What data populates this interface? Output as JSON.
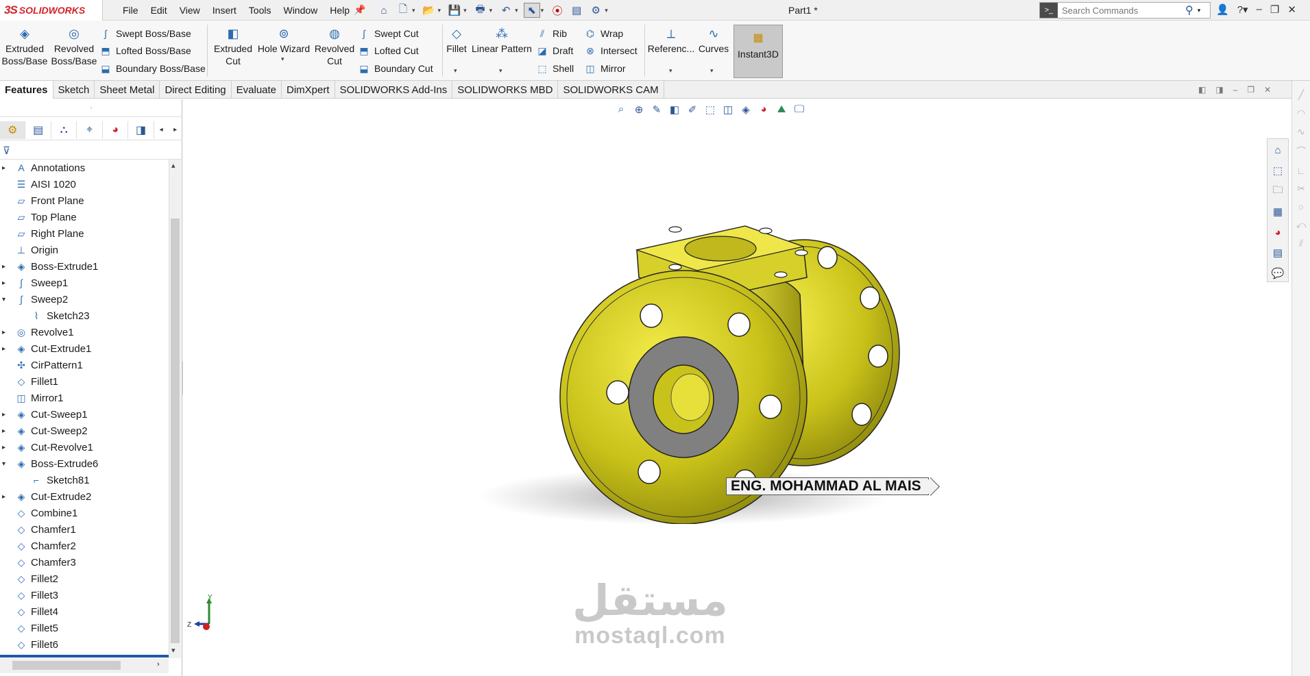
{
  "app": {
    "logo_ds": "3S",
    "logo_text": "SOLIDWORKS",
    "document_title": "Part1 *"
  },
  "menu": [
    "File",
    "Edit",
    "View",
    "Insert",
    "Tools",
    "Window",
    "Help"
  ],
  "search": {
    "placeholder": "Search Commands"
  },
  "commands": {
    "extruded_boss": "Extruded\nBoss/Base",
    "revolved_boss": "Revolved\nBoss/Base",
    "swept_boss": "Swept Boss/Base",
    "lofted_boss": "Lofted Boss/Base",
    "boundary_boss": "Boundary Boss/Base",
    "extruded_cut": "Extruded\nCut",
    "hole_wizard": "Hole Wizard",
    "revolved_cut": "Revolved\nCut",
    "swept_cut": "Swept Cut",
    "lofted_cut": "Lofted Cut",
    "boundary_cut": "Boundary Cut",
    "fillet": "Fillet",
    "linear_pattern": "Linear Pattern",
    "rib": "Rib",
    "draft": "Draft",
    "shell": "Shell",
    "wrap": "Wrap",
    "intersect": "Intersect",
    "mirror": "Mirror",
    "reference": "Referenc...",
    "curves": "Curves",
    "instant3d": "Instant3D"
  },
  "tabs": [
    "Features",
    "Sketch",
    "Sheet Metal",
    "Direct Editing",
    "Evaluate",
    "DimXpert",
    "SOLIDWORKS Add-Ins",
    "SOLIDWORKS MBD",
    "SOLIDWORKS CAM"
  ],
  "active_tab": "Features",
  "tree": [
    {
      "label": "Annotations",
      "icon": "annotations-icon",
      "glyph": "A",
      "expand": "▸"
    },
    {
      "label": "AISI 1020",
      "icon": "material-icon",
      "glyph": "☰",
      "expand": ""
    },
    {
      "label": "Front Plane",
      "icon": "plane-icon",
      "glyph": "▱",
      "expand": ""
    },
    {
      "label": "Top Plane",
      "icon": "plane-icon",
      "glyph": "▱",
      "expand": ""
    },
    {
      "label": "Right Plane",
      "icon": "plane-icon",
      "glyph": "▱",
      "expand": ""
    },
    {
      "label": "Origin",
      "icon": "origin-icon",
      "glyph": "⊥",
      "expand": ""
    },
    {
      "label": "Boss-Extrude1",
      "icon": "boss-extrude-icon",
      "glyph": "◈",
      "expand": "▸"
    },
    {
      "label": "Sweep1",
      "icon": "sweep-icon",
      "glyph": "∫",
      "expand": "▸"
    },
    {
      "label": "Sweep2",
      "icon": "sweep-icon",
      "glyph": "∫",
      "expand": "▾"
    },
    {
      "label": "Sketch23",
      "icon": "sketch-icon",
      "glyph": "⌇",
      "expand": "",
      "child": true
    },
    {
      "label": "Revolve1",
      "icon": "revolve-icon",
      "glyph": "◎",
      "expand": "▸"
    },
    {
      "label": "Cut-Extrude1",
      "icon": "cut-extrude-icon",
      "glyph": "◈",
      "expand": "▸"
    },
    {
      "label": "CirPattern1",
      "icon": "circular-pattern-icon",
      "glyph": "✣",
      "expand": ""
    },
    {
      "label": "Fillet1",
      "icon": "fillet-icon",
      "glyph": "◇",
      "expand": ""
    },
    {
      "label": "Mirror1",
      "icon": "mirror-icon",
      "glyph": "◫",
      "expand": ""
    },
    {
      "label": "Cut-Sweep1",
      "icon": "cut-sweep-icon",
      "glyph": "◈",
      "expand": "▸"
    },
    {
      "label": "Cut-Sweep2",
      "icon": "cut-sweep-icon",
      "glyph": "◈",
      "expand": "▸"
    },
    {
      "label": "Cut-Revolve1",
      "icon": "cut-revolve-icon",
      "glyph": "◈",
      "expand": "▸"
    },
    {
      "label": "Boss-Extrude6",
      "icon": "boss-extrude-icon",
      "glyph": "◈",
      "expand": "▾"
    },
    {
      "label": "Sketch81",
      "icon": "sketch-icon",
      "glyph": "⌐",
      "expand": "",
      "child": true
    },
    {
      "label": "Cut-Extrude2",
      "icon": "cut-extrude-icon",
      "glyph": "◈",
      "expand": "▸"
    },
    {
      "label": "Combine1",
      "icon": "combine-icon",
      "glyph": "◇",
      "expand": ""
    },
    {
      "label": "Chamfer1",
      "icon": "chamfer-icon",
      "glyph": "◇",
      "expand": ""
    },
    {
      "label": "Chamfer2",
      "icon": "chamfer-icon",
      "glyph": "◇",
      "expand": ""
    },
    {
      "label": "Chamfer3",
      "icon": "chamfer-icon",
      "glyph": "◇",
      "expand": ""
    },
    {
      "label": "Fillet2",
      "icon": "fillet-icon",
      "glyph": "◇",
      "expand": ""
    },
    {
      "label": "Fillet3",
      "icon": "fillet-icon",
      "glyph": "◇",
      "expand": ""
    },
    {
      "label": "Fillet4",
      "icon": "fillet-icon",
      "glyph": "◇",
      "expand": ""
    },
    {
      "label": "Fillet5",
      "icon": "fillet-icon",
      "glyph": "◇",
      "expand": ""
    },
    {
      "label": "Fillet6",
      "icon": "fillet-icon",
      "glyph": "◇",
      "expand": ""
    }
  ],
  "viewport": {
    "annotation_text": "ENG. MOHAMMAD AL MAIS",
    "triad_y": "Y",
    "triad_z": "Z",
    "watermark_ar": "مستقل",
    "watermark_lat": "mostaql.com"
  },
  "colors": {
    "part_yellow": "#c9c21a",
    "part_dark": "#8f8a0d",
    "face_grey": "#808080",
    "brand_red": "#d2232a"
  }
}
